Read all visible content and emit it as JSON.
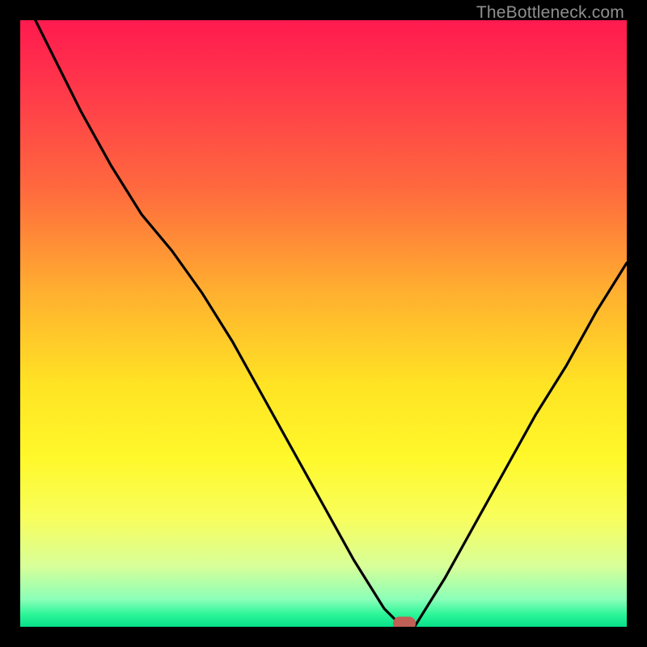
{
  "watermark": "TheBottleneck.com",
  "chart_data": {
    "type": "line",
    "title": "",
    "xlabel": "",
    "ylabel": "",
    "x": [
      0.0,
      0.05,
      0.1,
      0.15,
      0.2,
      0.25,
      0.3,
      0.35,
      0.4,
      0.45,
      0.5,
      0.55,
      0.6,
      0.63,
      0.65,
      0.7,
      0.75,
      0.8,
      0.85,
      0.9,
      0.95,
      1.0
    ],
    "values": [
      1.05,
      0.95,
      0.85,
      0.76,
      0.68,
      0.62,
      0.55,
      0.47,
      0.38,
      0.29,
      0.2,
      0.11,
      0.03,
      0.0,
      0.0,
      0.08,
      0.17,
      0.26,
      0.35,
      0.43,
      0.52,
      0.6
    ],
    "xlim": [
      0,
      1
    ],
    "ylim": [
      0,
      1
    ],
    "marker": {
      "x": 0.633,
      "y": 0.005
    },
    "gradient_stops": [
      {
        "pos": 0.0,
        "color": "#ff1a4f"
      },
      {
        "pos": 0.12,
        "color": "#ff3a4a"
      },
      {
        "pos": 0.28,
        "color": "#ff6a3e"
      },
      {
        "pos": 0.45,
        "color": "#ffb02f"
      },
      {
        "pos": 0.6,
        "color": "#ffe324"
      },
      {
        "pos": 0.72,
        "color": "#fff82a"
      },
      {
        "pos": 0.82,
        "color": "#f8fe5c"
      },
      {
        "pos": 0.9,
        "color": "#d8ff99"
      },
      {
        "pos": 0.955,
        "color": "#8affb8"
      },
      {
        "pos": 0.98,
        "color": "#2bf598"
      },
      {
        "pos": 1.0,
        "color": "#08e089"
      }
    ]
  }
}
